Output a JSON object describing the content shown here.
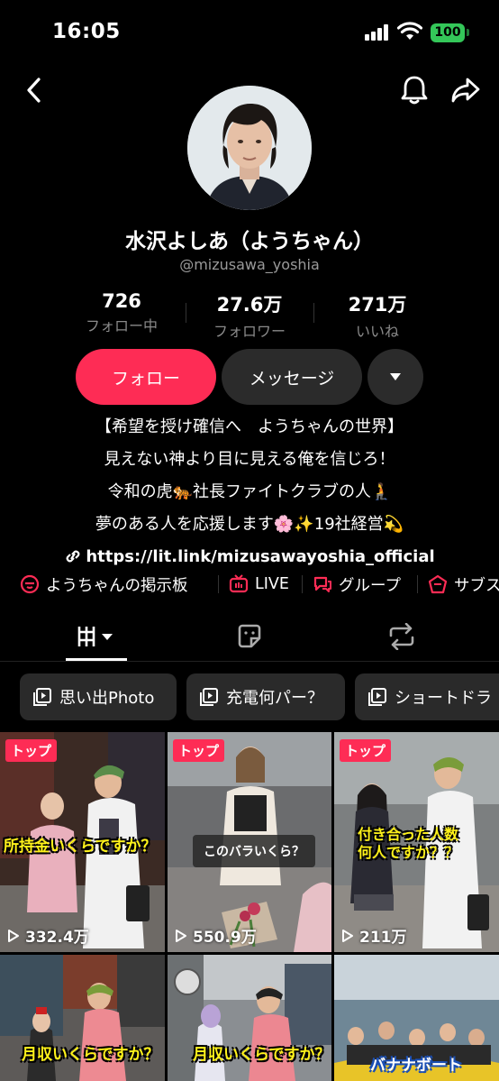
{
  "status_bar": {
    "time": "16:05",
    "battery": "100"
  },
  "profile": {
    "display_name": "水沢よしあ（ようちゃん）",
    "username": "@mizusawa_yoshia"
  },
  "stats": [
    {
      "value": "726",
      "label": "フォロー中"
    },
    {
      "value": "27.6万",
      "label": "フォロワー"
    },
    {
      "value": "271万",
      "label": "いいね"
    }
  ],
  "actions": {
    "follow": "フォロー",
    "message": "メッセージ"
  },
  "bio": {
    "lines": [
      "【希望を授け確信へ　ようちゃんの世界】",
      "見えない神より目に見える俺を信じろ！",
      "令和の虎🐅社長ファイトクラブの人🧎",
      "夢のある人を応援します🌸✨19社経営💫"
    ],
    "link": "https://lit.link/mizusawayoshia_official"
  },
  "links": [
    {
      "label": "ようちゃんの掲示板",
      "icon": "board-icon"
    },
    {
      "label": "LIVE",
      "icon": "live-icon"
    },
    {
      "label": "グループ",
      "icon": "group-chat-icon"
    },
    {
      "label": "サブス",
      "icon": "subscription-icon"
    }
  ],
  "playlists": [
    {
      "label": "思い出Photo"
    },
    {
      "label": "充電何パー？"
    },
    {
      "label": "ショートドラ"
    }
  ],
  "videos": [
    {
      "badge": "トップ",
      "views": "332.4万",
      "caption": "所持金いくらですか？"
    },
    {
      "badge": "トップ",
      "views": "550.9万",
      "caption": "このバラいくら？"
    },
    {
      "badge": "トップ",
      "views": "211万",
      "caption": "付き合った人数\n何人ですか？？"
    },
    {
      "badge": "",
      "views": "",
      "caption": "月収いくらですか？"
    },
    {
      "badge": "",
      "views": "",
      "caption": "月収いくらですか？"
    },
    {
      "badge": "",
      "views": "",
      "caption": "バナナボート"
    }
  ],
  "colors": {
    "accent": "#fe2c55",
    "background": "#000000",
    "chip": "#2b2b2b"
  }
}
